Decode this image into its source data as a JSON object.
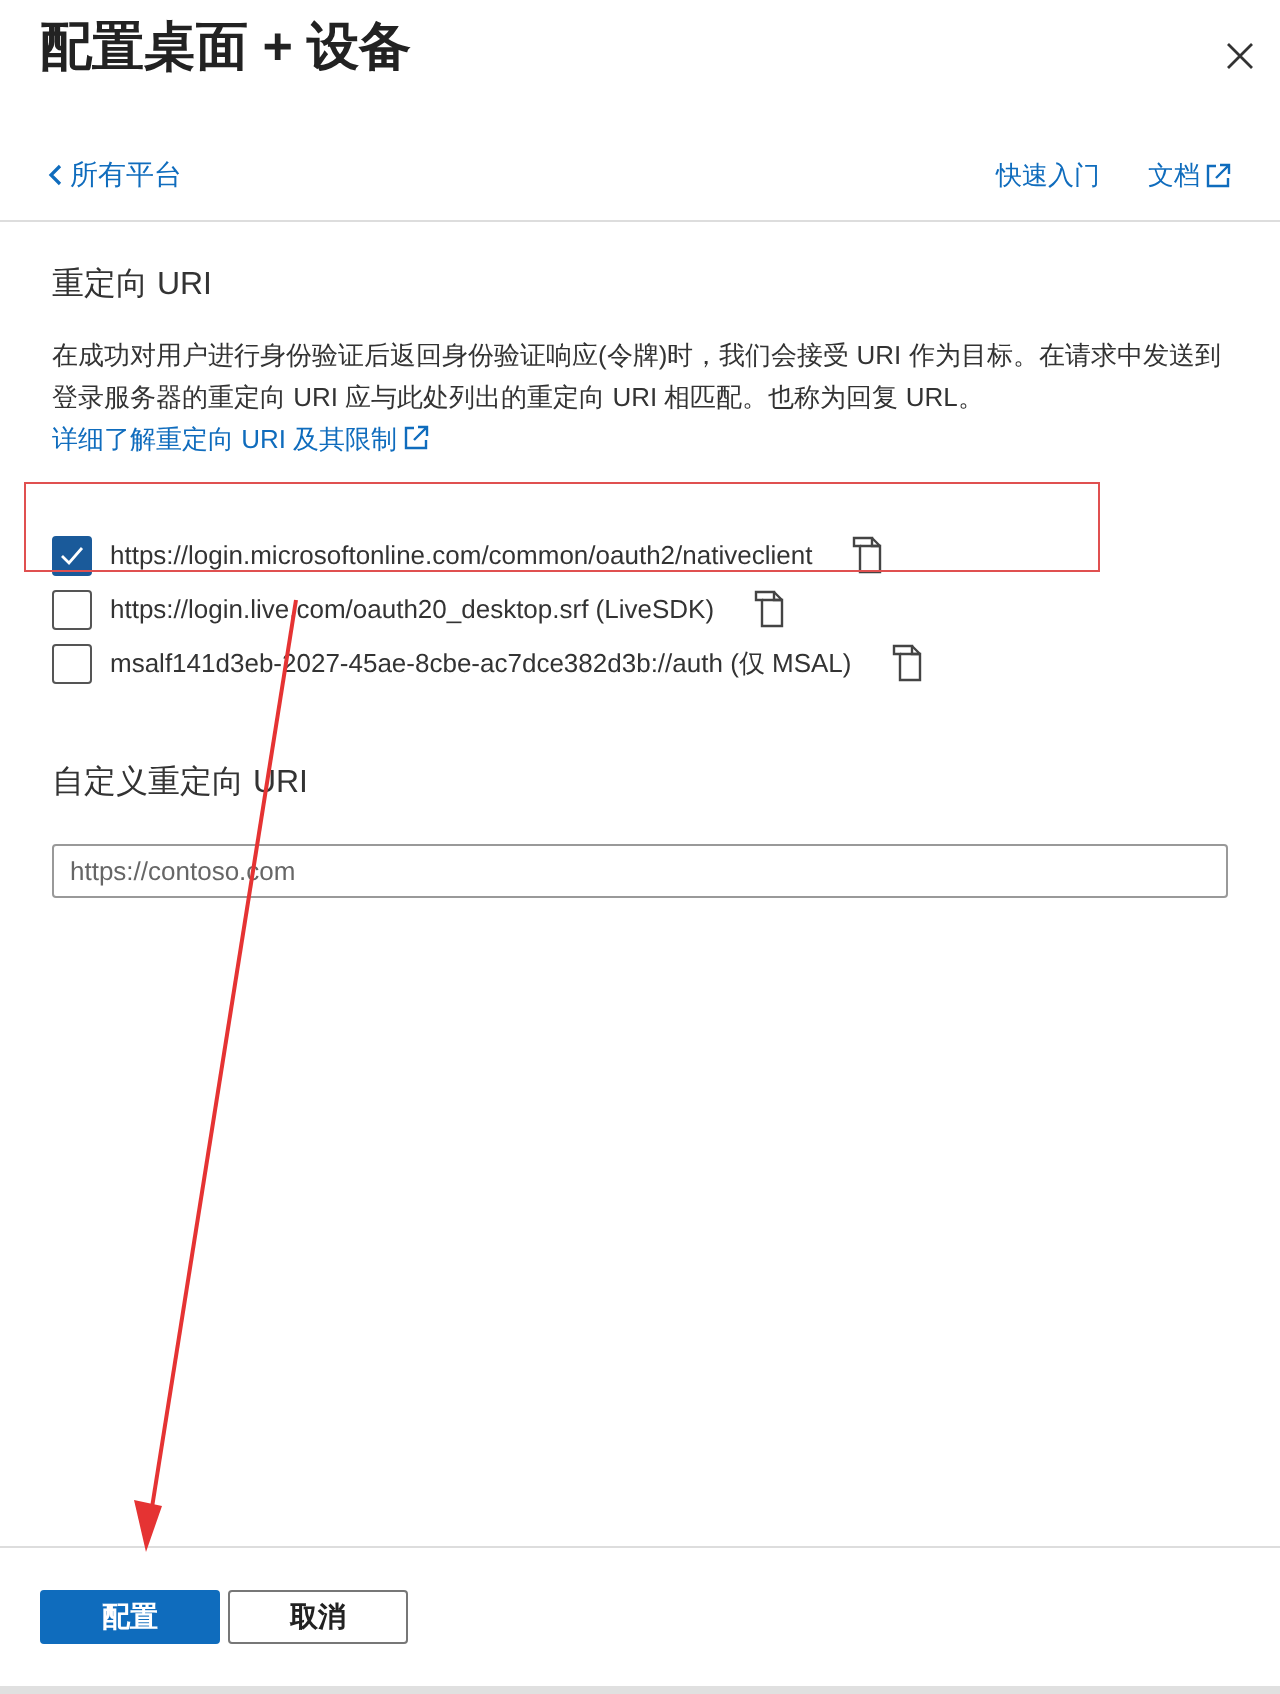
{
  "window": {
    "title": "配置桌面 + 设备"
  },
  "nav": {
    "back": "所有平台",
    "links": [
      {
        "label": "快速入门",
        "external": false
      },
      {
        "label": "文档",
        "external": true
      }
    ]
  },
  "redirect": {
    "heading": "重定向 URI",
    "description": "在成功对用户进行身份验证后返回身份验证响应(令牌)时，我们会接受 URI 作为目标。在请求中发送到登录服务器的重定向 URI 应与此处列出的重定向 URI 相匹配。也称为回复 URL。",
    "link": "详细了解重定向 URI 及其限制",
    "options": [
      {
        "uri": "https://login.microsoftonline.com/common/oauth2/nativeclient",
        "checked": true
      },
      {
        "uri": "https://login.live.com/oauth20_desktop.srf (LiveSDK)",
        "checked": false
      },
      {
        "uri": "msalf141d3eb-2027-45ae-8cbe-ac7dce382d3b://auth (仅 MSAL)",
        "checked": false
      }
    ]
  },
  "custom": {
    "heading": "自定义重定向 URI",
    "placeholder": "https://contoso.com"
  },
  "buttons": [
    {
      "label": "配置",
      "kind": "primary"
    },
    {
      "label": "取消",
      "kind": "secondary"
    }
  ]
}
